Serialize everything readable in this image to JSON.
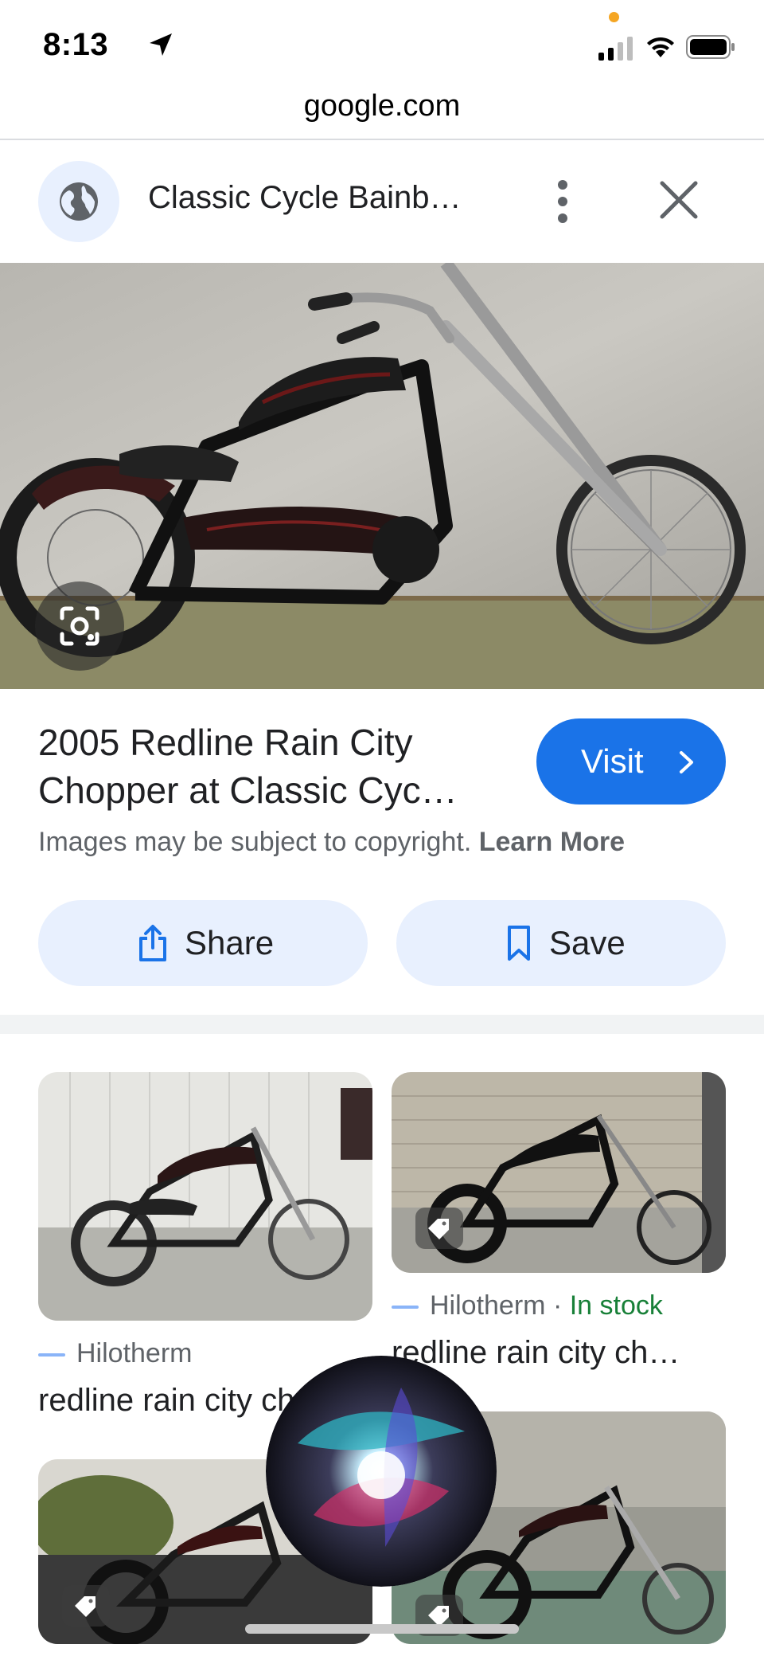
{
  "status_bar": {
    "time": "8:13"
  },
  "browser": {
    "url": "google.com"
  },
  "tab": {
    "title": "Classic Cycle Bainb…"
  },
  "result": {
    "title_line1": "2005 Redline Rain City",
    "title_line2": "Chopper at Classic Cyc…",
    "visit_label": "Visit",
    "copyright_text": "Images may be subject to copyright.",
    "learn_more": "Learn More",
    "share_label": "Share",
    "save_label": "Save"
  },
  "related": [
    {
      "source": "Hilotherm",
      "stock": "",
      "caption": "redline rain city ch"
    },
    {
      "source": "Hilotherm",
      "separator": "·",
      "stock": "In stock",
      "caption": "redline rain city ch…"
    }
  ],
  "colors": {
    "accent": "#1a73e8",
    "pill_bg": "#e8f0fe",
    "in_stock": "#188038"
  }
}
